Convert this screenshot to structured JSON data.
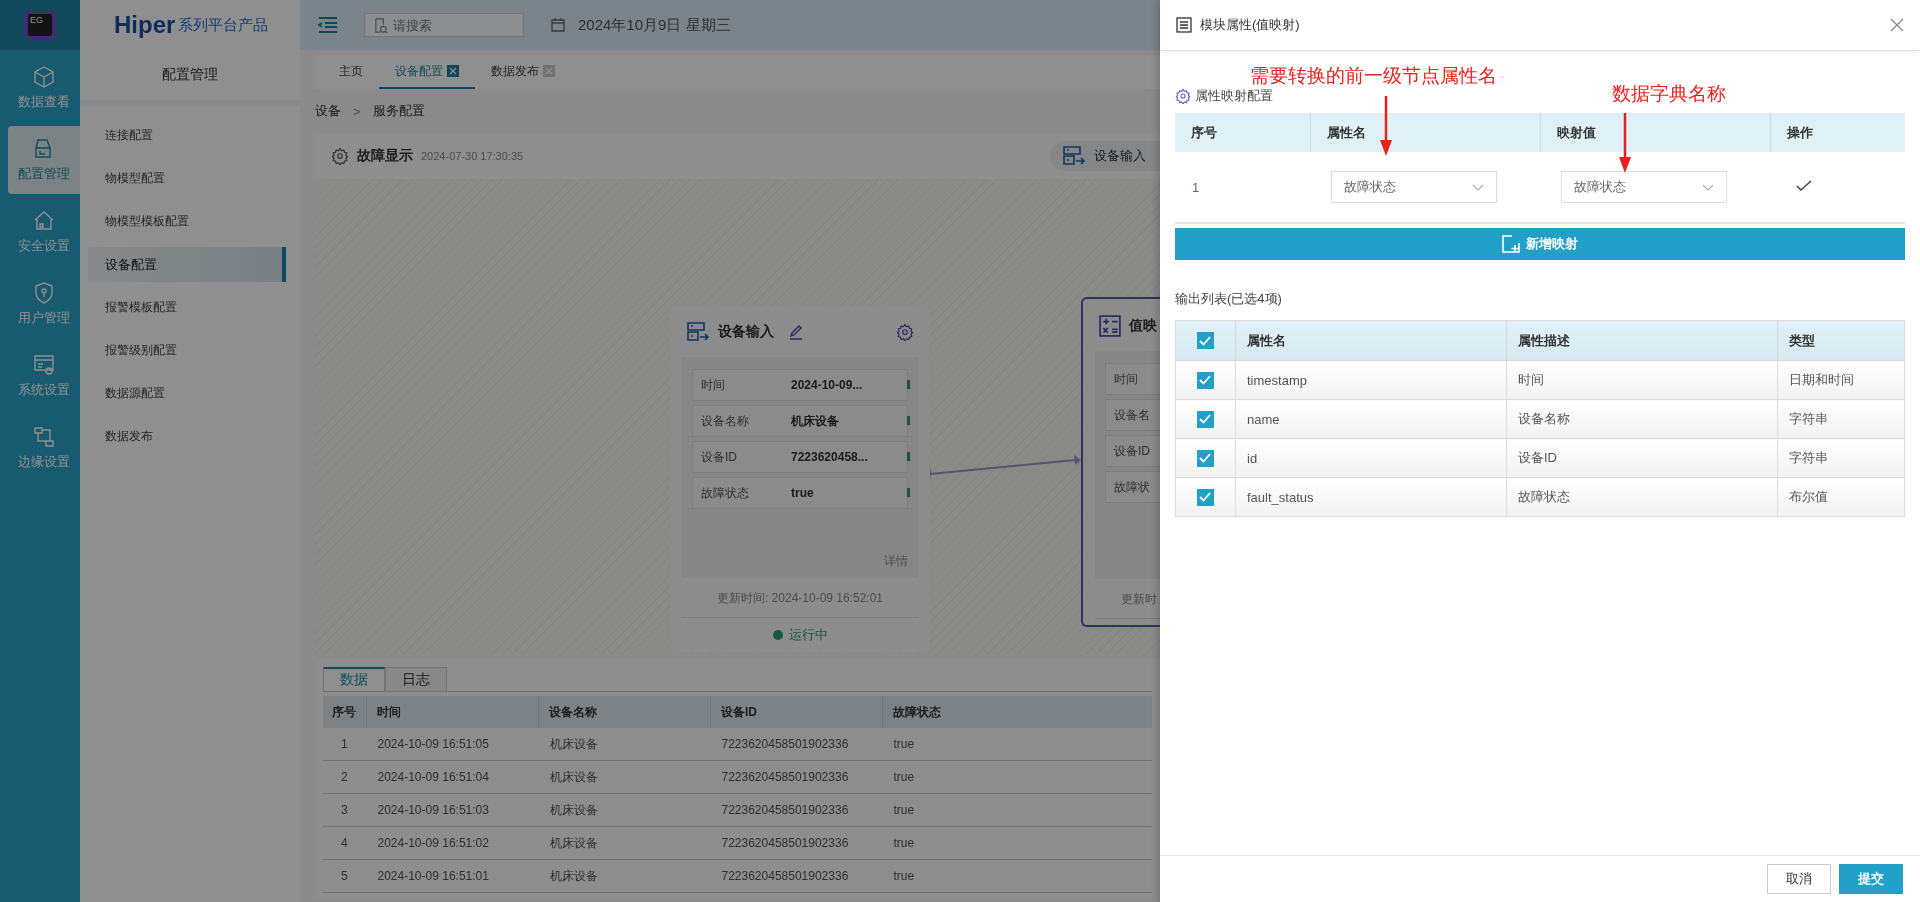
{
  "rail": {
    "logo_text": "EG",
    "items": [
      {
        "label": "数据查看",
        "selected": false
      },
      {
        "label": "配置管理",
        "selected": true
      },
      {
        "label": "安全设置",
        "selected": false
      },
      {
        "label": "用户管理",
        "selected": false
      },
      {
        "label": "系统设置",
        "selected": false
      },
      {
        "label": "边缘设置",
        "selected": false
      }
    ]
  },
  "brand": {
    "name": "Hiper",
    "tagline": "系列平台产品"
  },
  "sidebar": {
    "title": "配置管理",
    "items": [
      {
        "label": "连接配置",
        "selected": false
      },
      {
        "label": "物模型配置",
        "selected": false
      },
      {
        "label": "物模型模板配置",
        "selected": false
      },
      {
        "label": "设备配置",
        "selected": true
      },
      {
        "label": "报警模板配置",
        "selected": false
      },
      {
        "label": "报警级别配置",
        "selected": false
      },
      {
        "label": "数据源配置",
        "selected": false
      },
      {
        "label": "数据发布",
        "selected": false
      }
    ]
  },
  "topbar": {
    "search": {
      "placeholder": "请搜索"
    },
    "date": "2024年10月9日 星期三"
  },
  "tabs": [
    {
      "label": "主页",
      "selected": false,
      "closable": false
    },
    {
      "label": "设备配置",
      "selected": true,
      "closable": true
    },
    {
      "label": "数据发布",
      "selected": false,
      "closable": true
    }
  ],
  "breadcrumb": {
    "items": [
      "设备",
      "服务配置"
    ],
    "separator": ">"
  },
  "flow": {
    "title": "故障显示",
    "time": "2024-07-30 17:30:35",
    "toolbar_item": "设备输入",
    "nodes": [
      {
        "kind": "input",
        "title": "设备输入",
        "fields": [
          {
            "label": "时间",
            "value": "2024-10-09..."
          },
          {
            "label": "设备名称",
            "value": "机床设备"
          },
          {
            "label": "设备ID",
            "value": "7223620458..."
          },
          {
            "label": "故障状态",
            "value": "true"
          }
        ],
        "detail": "详情",
        "updated": "更新时间: 2024-10-09 16:52:01",
        "status": "运行中"
      },
      {
        "kind": "mapping",
        "title": "值映",
        "fields": [
          {
            "label": "时间"
          },
          {
            "label": "设备名"
          },
          {
            "label": "设备ID"
          },
          {
            "label": "故障状"
          }
        ],
        "updated": "更新时"
      }
    ]
  },
  "bottom": {
    "tabs": [
      {
        "label": "数据",
        "selected": true
      },
      {
        "label": "日志",
        "selected": false
      }
    ],
    "columns": [
      "序号",
      "时间",
      "设备名称",
      "设备ID",
      "故障状态"
    ],
    "rows": [
      [
        "1",
        "2024-10-09 16:51:05",
        "机床设备",
        "7223620458501902336",
        "true"
      ],
      [
        "2",
        "2024-10-09 16:51:04",
        "机床设备",
        "7223620458501902336",
        "true"
      ],
      [
        "3",
        "2024-10-09 16:51:03",
        "机床设备",
        "7223620458501902336",
        "true"
      ],
      [
        "4",
        "2024-10-09 16:51:02",
        "机床设备",
        "7223620458501902336",
        "true"
      ],
      [
        "5",
        "2024-10-09 16:51:01",
        "机床设备",
        "7223620458501902336",
        "true"
      ]
    ]
  },
  "drawer": {
    "title": "模块属性(值映射)",
    "section_title": "属性映射配置",
    "annotations": [
      "需要转换的前一级节点属性名",
      "数据字典名称"
    ],
    "mapping": {
      "columns": [
        "序号",
        "属性名",
        "映射值",
        "操作"
      ],
      "rows": [
        {
          "index": "1",
          "attribute": "故障状态",
          "value": "故障状态"
        }
      ],
      "add_button": "新增映射"
    },
    "output": {
      "title": "输出列表(已选4项)",
      "all_checked": true,
      "columns": [
        "属性名",
        "属性描述",
        "类型"
      ],
      "rows": [
        {
          "checked": true,
          "name": "timestamp",
          "description": "时间",
          "type": "日期和时间"
        },
        {
          "checked": true,
          "name": "name",
          "description": "设备名称",
          "type": "字符串"
        },
        {
          "checked": true,
          "name": "id",
          "description": "设备ID",
          "type": "字符串"
        },
        {
          "checked": true,
          "name": "fault_status",
          "description": "故障状态",
          "type": "布尔值"
        }
      ]
    },
    "buttons": [
      {
        "label": "取消",
        "kind": "secondary"
      },
      {
        "label": "提交",
        "kind": "primary"
      }
    ]
  }
}
